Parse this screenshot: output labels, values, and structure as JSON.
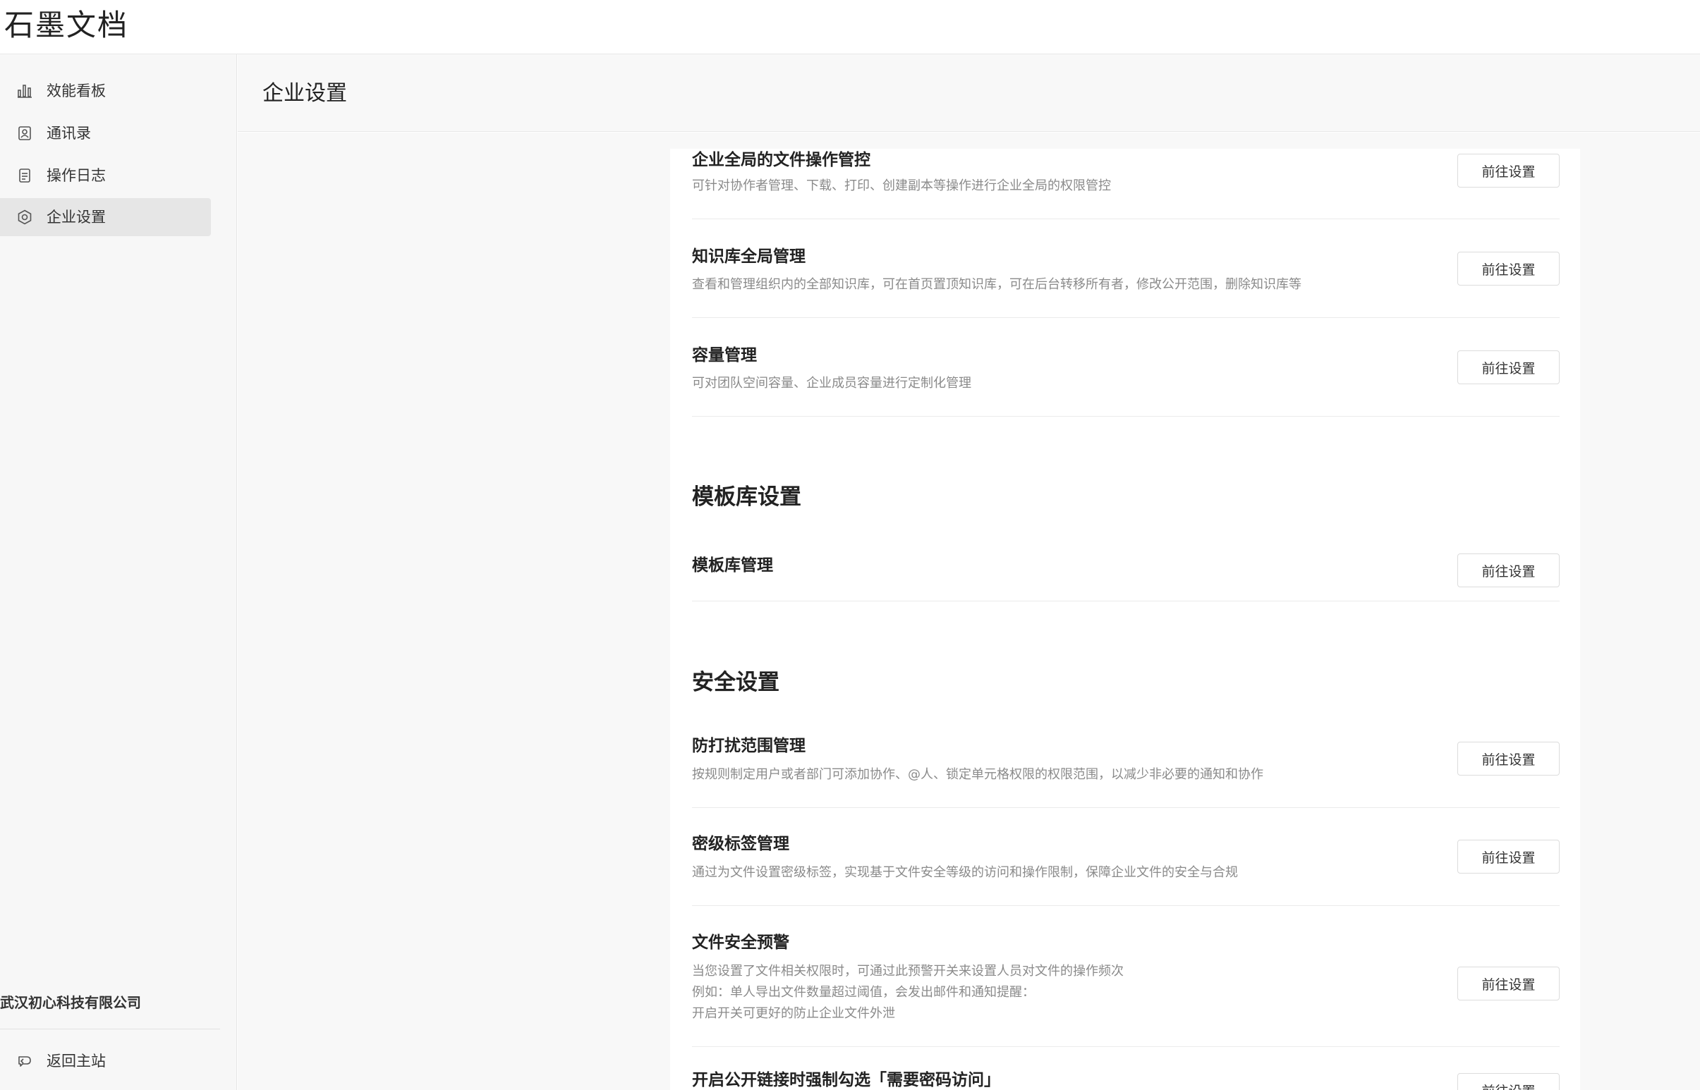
{
  "app": {
    "logo_text": "石墨文档"
  },
  "sidebar": {
    "items": [
      {
        "label": "效能看板",
        "icon": "bar-chart-icon"
      },
      {
        "label": "通讯录",
        "icon": "contacts-icon"
      },
      {
        "label": "操作日志",
        "icon": "log-icon"
      },
      {
        "label": "企业设置",
        "icon": "settings-icon",
        "active": true
      }
    ],
    "company_name": "武汉初心科技有限公司",
    "back_label": "返回主站"
  },
  "header": {
    "title": "企业设置"
  },
  "main": {
    "button_label": "前往设置",
    "rows_top": [
      {
        "title": "企业全局的文件操作管控",
        "desc": "可针对协作者管理、下载、打印、创建副本等操作进行企业全局的权限管控"
      },
      {
        "title": "知识库全局管理",
        "desc": "查看和管理组织内的全部知识库，可在首页置顶知识库，可在后台转移所有者，修改公开范围，删除知识库等"
      },
      {
        "title": "容量管理",
        "desc": "可对团队空间容量、企业成员容量进行定制化管理"
      }
    ],
    "template_section": {
      "title": "模板库设置",
      "rows": [
        {
          "title": "模板库管理"
        }
      ]
    },
    "security_section": {
      "title": "安全设置",
      "rows": [
        {
          "title": "防打扰范围管理",
          "desc": "按规则制定用户或者部门可添加协作、@人、锁定单元格权限的权限范围，以减少非必要的通知和协作"
        },
        {
          "title": "密级标签管理",
          "desc": "通过为文件设置密级标签，实现基于文件安全等级的访问和操作限制，保障企业文件的安全与合规"
        },
        {
          "title": "文件安全预警",
          "desc_lines": [
            "当您设置了文件相关权限时，可通过此预警开关来设置人员对文件的操作频次",
            "例如：单人导出文件数量超过阈值，会发出邮件和通知提醒：",
            "开启开关可更好的防止企业文件外泄"
          ]
        },
        {
          "title": "开启公开链接时强制勾选「需要密码访问」"
        }
      ]
    }
  },
  "colors": {
    "sidebar_bg": "#f7f7f7",
    "active_bg": "#e6e6e6",
    "text": "#333333",
    "desc_text": "#8a8a8a"
  }
}
